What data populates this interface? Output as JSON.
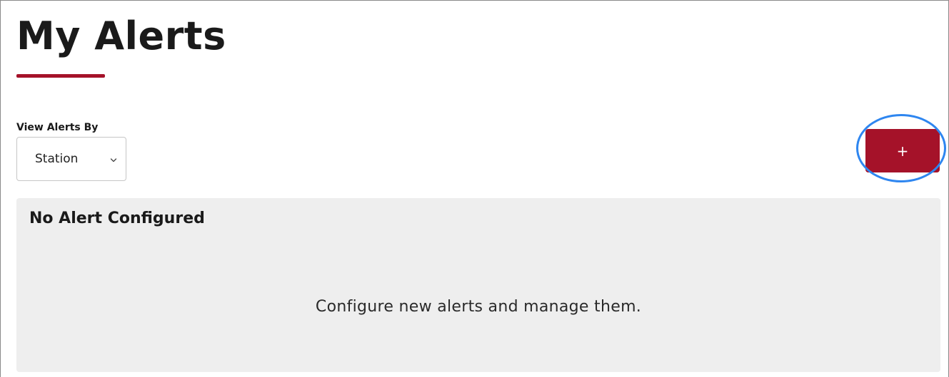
{
  "page": {
    "title": "My Alerts"
  },
  "filter": {
    "label": "View Alerts By",
    "selected": "Station"
  },
  "actions": {
    "add_label": "+"
  },
  "empty_state": {
    "title": "No Alert Configured",
    "message": "Configure new alerts and manage them."
  },
  "colors": {
    "brand": "#a51229",
    "focus_ring": "#2e86f0",
    "panel_bg": "#eeeeee"
  },
  "icons": {
    "select_chevron": "chevron-down-icon"
  }
}
